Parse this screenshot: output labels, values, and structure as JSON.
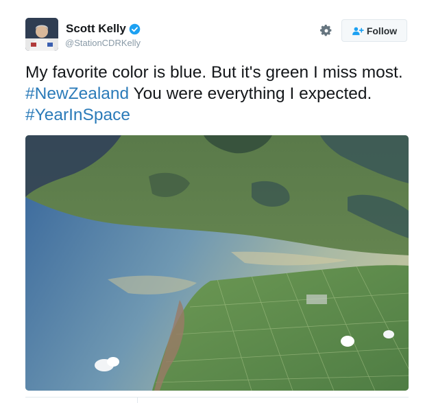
{
  "author": {
    "name": "Scott Kelly",
    "handle": "@StationCDRKelly",
    "verified_icon": "verified-badge-icon",
    "avatar_icon": "astronaut-avatar"
  },
  "actions": {
    "settings_icon": "gear-icon",
    "follow_label": "Follow",
    "follow_icon": "add-user-icon"
  },
  "tweet": {
    "text_1": "My favorite color is blue. But it's green I miss most. ",
    "hashtag_1": "#NewZealand",
    "text_2": " You were everything I expected. ",
    "hashtag_2": "#YearInSpace"
  },
  "colors": {
    "hashtag": "#2b7bb9",
    "verified": "#1da1f2",
    "handle": "#8899a6"
  }
}
